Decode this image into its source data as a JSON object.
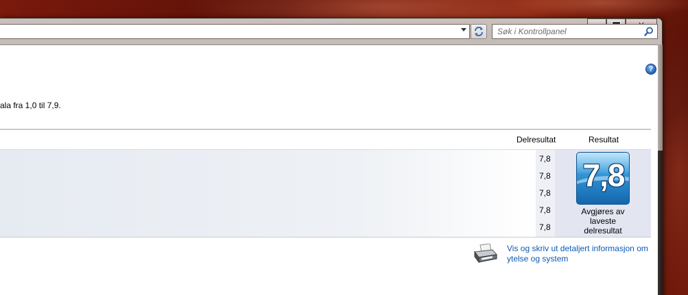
{
  "titlebar": {
    "buttons": [
      "minimize",
      "maximize",
      "close"
    ],
    "close_label": "✕"
  },
  "address": {
    "search_placeholder": "Søk i Kontrollpanel"
  },
  "main": {
    "help_label": "?",
    "scale_text": "ala fra 1,0 til 7,9.",
    "headers": {
      "subscore": "Delresultat",
      "result": "Resultat"
    },
    "subscores": [
      "7,8",
      "7,8",
      "7,8",
      "7,8",
      "7,8"
    ],
    "base_score": "7,8",
    "score_caption": [
      "Avgjøres av",
      "laveste",
      "delresultat"
    ],
    "print_link": [
      "Vis og skriv ut detaljert informasjon om",
      "ytelse og system"
    ]
  },
  "colors": {
    "link": "#0a5bb4",
    "badge": "#2f93d6",
    "desktop": "#6e1709"
  },
  "icons": {
    "help": "help-icon",
    "search": "search-icon",
    "refresh": "refresh-icon",
    "printer": "printer-icon"
  }
}
